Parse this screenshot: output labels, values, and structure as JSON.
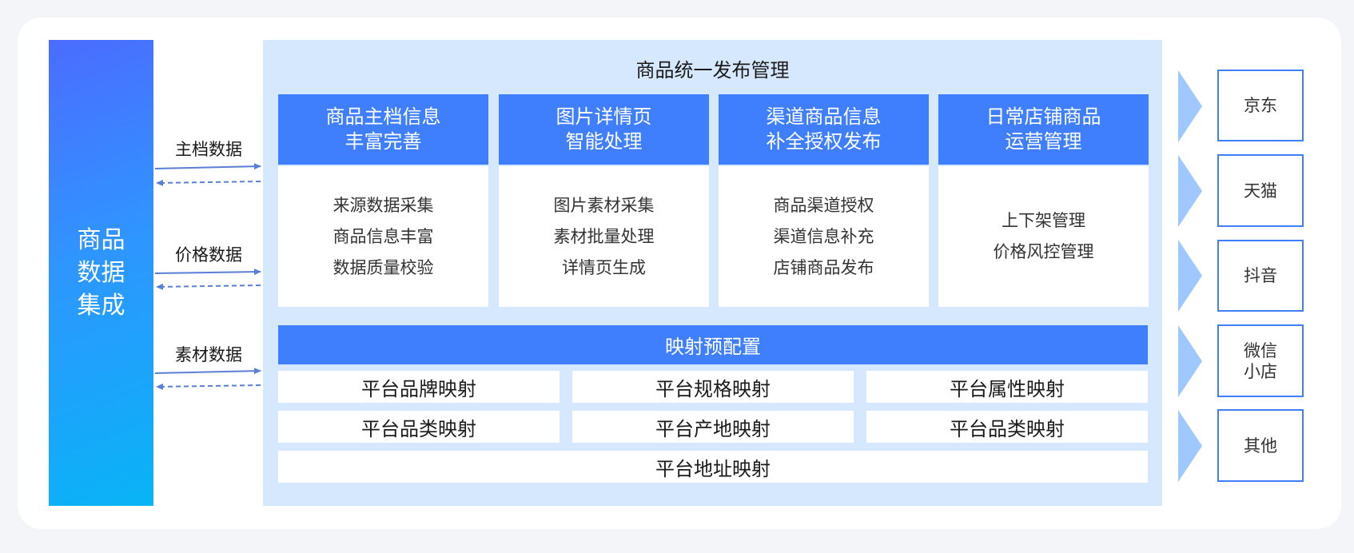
{
  "left": {
    "title": "商品数据集成"
  },
  "flows": [
    {
      "label": "主档数据"
    },
    {
      "label": "价格数据"
    },
    {
      "label": "素材数据"
    }
  ],
  "main": {
    "title": "商品统一发布管理",
    "modules": [
      {
        "title_line1": "商品主档信息",
        "title_line2": "丰富完善",
        "items": [
          "来源数据采集",
          "商品信息丰富",
          "数据质量校验"
        ]
      },
      {
        "title_line1": "图片详情页",
        "title_line2": "智能处理",
        "items": [
          "图片素材采集",
          "素材批量处理",
          "详情页生成"
        ]
      },
      {
        "title_line1": "渠道商品信息",
        "title_line2": "补全授权发布",
        "items": [
          "商品渠道授权",
          "渠道信息补充",
          "店铺商品发布"
        ]
      },
      {
        "title_line1": "日常店铺商品",
        "title_line2": "运营管理",
        "items": [
          "上下架管理",
          "价格风控管理"
        ]
      }
    ],
    "mapping": {
      "title": "映射预配置",
      "cells": [
        "平台品牌映射",
        "平台规格映射",
        "平台属性映射",
        "平台品类映射",
        "平台产地映射",
        "平台品类映射",
        "平台地址映射"
      ]
    }
  },
  "platforms": [
    {
      "line1": "京东",
      "line2": ""
    },
    {
      "line1": "天猫",
      "line2": ""
    },
    {
      "line1": "抖音",
      "line2": ""
    },
    {
      "line1": "微信",
      "line2": "小店"
    },
    {
      "line1": "其他",
      "line2": ""
    }
  ],
  "colors": {
    "primary": "#3f7ffe",
    "panel": "#d6e8fd",
    "arrow": "#5b7fd6",
    "chevron": "#9ec8ff"
  }
}
